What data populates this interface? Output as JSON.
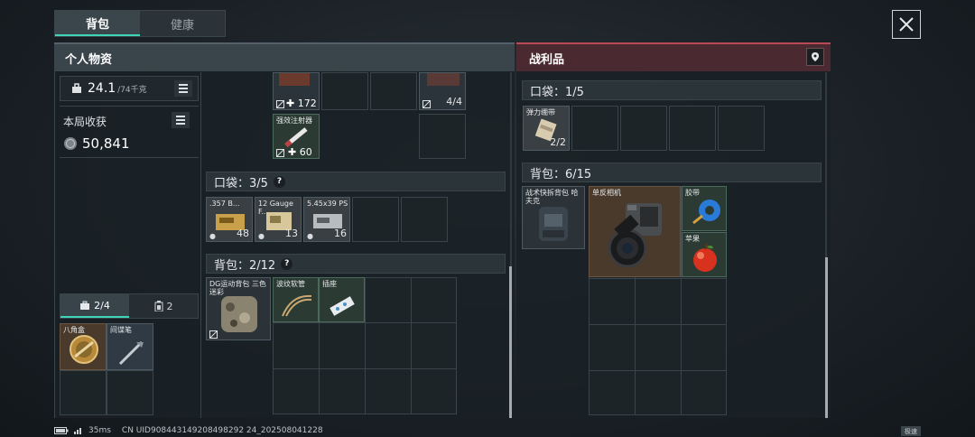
{
  "tabs": [
    "背包",
    "健康"
  ],
  "left_header": "个人物资",
  "right_header": "战利品",
  "weight": {
    "value": "24.1",
    "max": "/74千克"
  },
  "income": {
    "label": "本局收获",
    "value": "50,841"
  },
  "left_top": {
    "row1_count_a": "172",
    "row1_count_b": "4/4",
    "syringe_name": "强效注射器",
    "syringe_count": "60"
  },
  "pocket_left": {
    "label": "口袋：3/5",
    "items": [
      {
        "name": ".357 B...",
        "count": "48"
      },
      {
        "name": "12 Gauge F...",
        "count": "13"
      },
      {
        "name": "5.45x39 PS",
        "count": "16"
      }
    ]
  },
  "backpack_left": {
    "label": "背包：2/12",
    "items": [
      {
        "name": "DG运动背包 三色迷彩"
      },
      {
        "name": "波纹软管"
      },
      {
        "name": "插座"
      }
    ]
  },
  "gear_tabs": {
    "tab1": "2/4",
    "tab2": "2"
  },
  "gear_items": [
    {
      "name": "八角盒"
    },
    {
      "name": "间谍笔"
    }
  ],
  "pocket_right": {
    "label": "口袋：1/5",
    "items": [
      {
        "name": "弹力绷带",
        "count": "2/2"
      }
    ]
  },
  "backpack_right": {
    "label": "背包：6/15",
    "items": [
      {
        "name": "战术快拆背包 哈夫克"
      },
      {
        "name": "单反相机"
      },
      {
        "name": "胶带"
      },
      {
        "name": "苹果"
      }
    ]
  },
  "status": {
    "ping": "35ms",
    "uid": "CN UID908443149208498292 24_202508041228",
    "speed": "极速"
  }
}
